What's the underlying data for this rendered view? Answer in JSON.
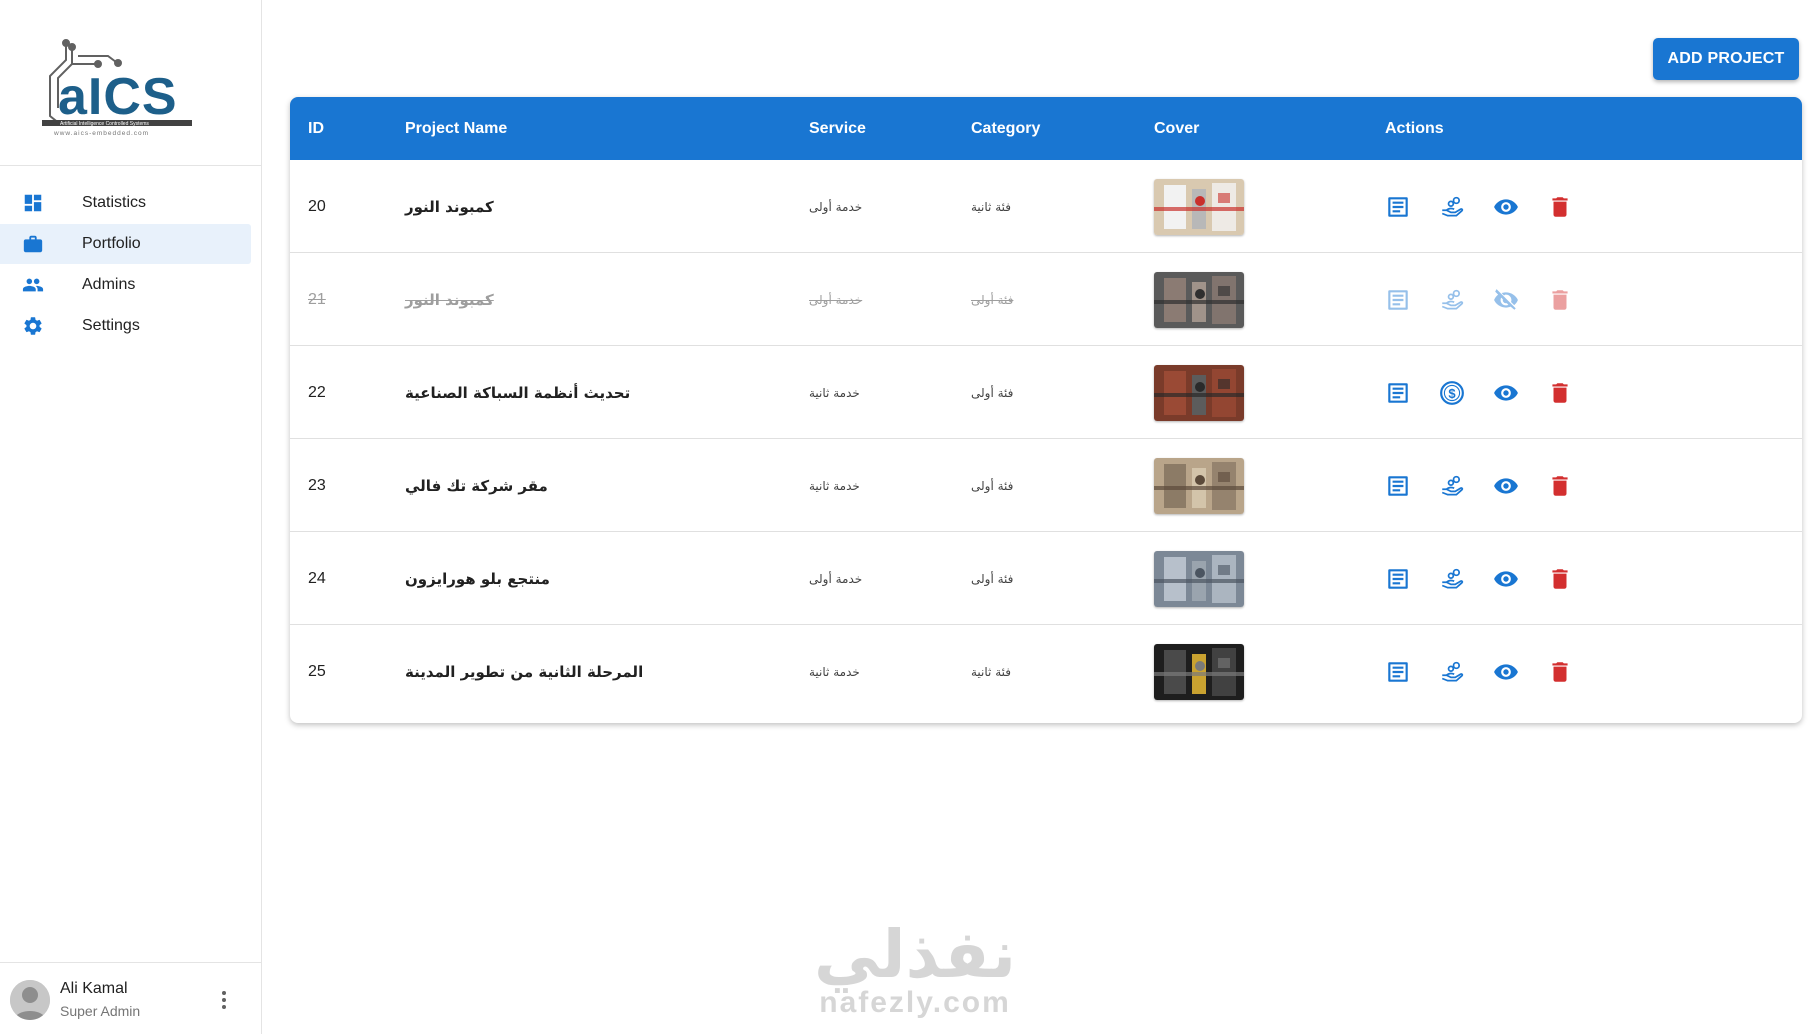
{
  "brand": {
    "logo_text": "aICS",
    "logo_tagline": "Artificial Intelligence Controlled Systems",
    "logo_url": "www.aics-embedded.com",
    "accent": "#1976d2"
  },
  "nav": {
    "items": [
      {
        "label": "Statistics",
        "icon": "dashboard-icon",
        "active": false
      },
      {
        "label": "Portfolio",
        "icon": "briefcase-icon",
        "active": true
      },
      {
        "label": "Admins",
        "icon": "people-icon",
        "active": false
      },
      {
        "label": "Settings",
        "icon": "gear-icon",
        "active": false
      }
    ]
  },
  "user": {
    "name": "Ali Kamal",
    "role": "Super Admin"
  },
  "toolbar": {
    "add_label": "ADD PROJECT"
  },
  "table": {
    "headers": {
      "id": "ID",
      "name": "Project Name",
      "service": "Service",
      "category": "Category",
      "cover": "Cover",
      "actions": "Actions"
    },
    "rows": [
      {
        "id": "20",
        "name": "كمبوند النور",
        "service": "خدمة أولى",
        "category": "فئة ثانية",
        "disabled": false,
        "hand_icon": "hand-coins-icon",
        "view_icon": "eye-icon"
      },
      {
        "id": "21",
        "name": "كمبوند النور",
        "service": "خدمة أولى",
        "category": "فئة أولى",
        "disabled": true,
        "hand_icon": "hand-coins-icon",
        "view_icon": "eye-off-icon"
      },
      {
        "id": "22",
        "name": "تحديث أنظمة السباكة الصناعية",
        "service": "خدمة ثانية",
        "category": "فئة أولى",
        "disabled": false,
        "hand_icon": "dollar-circle-icon",
        "view_icon": "eye-icon"
      },
      {
        "id": "23",
        "name": "مقر شركة تك فالي",
        "service": "خدمة ثانية",
        "category": "فئة أولى",
        "disabled": false,
        "hand_icon": "hand-coins-icon",
        "view_icon": "eye-icon"
      },
      {
        "id": "24",
        "name": "منتجع بلو هورايزون",
        "service": "خدمة أولى",
        "category": "فئة أولى",
        "disabled": false,
        "hand_icon": "hand-coins-icon",
        "view_icon": "eye-icon"
      },
      {
        "id": "25",
        "name": "المرحلة الثانية من تطوير المدينة",
        "service": "خدمة ثانية",
        "category": "فئة ثانية",
        "disabled": false,
        "hand_icon": "hand-coins-icon",
        "view_icon": "eye-icon"
      }
    ]
  },
  "watermark": {
    "arabic": "نفذلي",
    "latin": "nafezly.com"
  }
}
